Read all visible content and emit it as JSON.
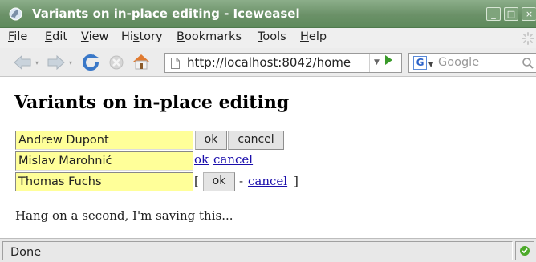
{
  "window": {
    "title": "Variants on in-place editing - Iceweasel",
    "minimize_label": "_",
    "maximize_label": "□",
    "close_label": "×"
  },
  "menubar": {
    "items": [
      {
        "first": "F",
        "rest": "ile"
      },
      {
        "first": "E",
        "rest": "dit"
      },
      {
        "first": "V",
        "rest": "iew"
      },
      {
        "pre": "Hi",
        "first": "s",
        "rest": "tory"
      },
      {
        "first": "B",
        "rest": "ookmarks"
      },
      {
        "first": "T",
        "rest": "ools"
      },
      {
        "first": "H",
        "rest": "elp"
      }
    ]
  },
  "navbar": {
    "url": "http://localhost:8042/home",
    "search_engine_label": "G",
    "search_placeholder": "Google"
  },
  "content": {
    "page_title": "Variants on in-place editing",
    "editors": [
      {
        "value": "Andrew Dupont",
        "ok_label": "ok",
        "cancel_label": "cancel"
      },
      {
        "value": "Mislav Marohnić",
        "ok_label": "ok",
        "cancel_label": "cancel"
      },
      {
        "value": "Thomas Fuchs",
        "open_bracket": "[",
        "ok_label": "ok",
        "dash": "-",
        "cancel_label": "cancel",
        "close_bracket": "]"
      }
    ],
    "saving_message": "Hang on a second, I'm saving this..."
  },
  "statusbar": {
    "text": "Done"
  },
  "colors": {
    "titlebar": "#6b9168",
    "editor_background": "#ffff99",
    "link": "#1a0dab"
  }
}
